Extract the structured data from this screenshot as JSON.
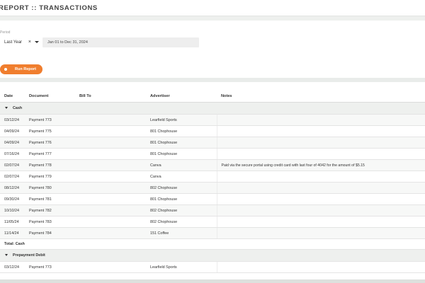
{
  "header": {
    "title": "REPORT :: TRANSACTIONS"
  },
  "filters": {
    "period_label": "Period",
    "period_value": "Last Year",
    "clear_icon": "×",
    "range": "Jan 01 to Dec 31, 2024"
  },
  "actions": {
    "run_label": "Run Report"
  },
  "table": {
    "columns": {
      "date": "Date",
      "document": "Document",
      "bill_to": "Bill To",
      "advertiser": "Advertiser",
      "notes": "Notes"
    },
    "groups": [
      {
        "name": "Cash",
        "rows": [
          {
            "date": "03/12/24",
            "document": "Payment 773",
            "bill_to": "",
            "advertiser": "Learfield Sports",
            "notes": ""
          },
          {
            "date": "04/09/24",
            "document": "Payment 775",
            "bill_to": "",
            "advertiser": "801 Chophouse",
            "notes": ""
          },
          {
            "date": "04/09/24",
            "document": "Payment 776",
            "bill_to": "",
            "advertiser": "801 Chophouse",
            "notes": ""
          },
          {
            "date": "07/16/24",
            "document": "Payment 777",
            "bill_to": "",
            "advertiser": "801 Chophouse",
            "notes": ""
          },
          {
            "date": "02/07/24",
            "document": "Payment 778",
            "bill_to": "",
            "advertiser": "Canva",
            "notes": "Paid via the secure portal using credit card with last four of 4042 for the amount of $5.15"
          },
          {
            "date": "02/07/24",
            "document": "Payment 779",
            "bill_to": "",
            "advertiser": "Canva",
            "notes": ""
          },
          {
            "date": "08/12/24",
            "document": "Payment 780",
            "bill_to": "",
            "advertiser": "802 Chophouse",
            "notes": ""
          },
          {
            "date": "09/30/24",
            "document": "Payment 781",
            "bill_to": "",
            "advertiser": "801 Chophouse",
            "notes": ""
          },
          {
            "date": "10/10/24",
            "document": "Payment 782",
            "bill_to": "",
            "advertiser": "802 Chophouse",
            "notes": ""
          },
          {
            "date": "11/05/24",
            "document": "Payment 783",
            "bill_to": "",
            "advertiser": "802 Chophouse",
            "notes": ""
          },
          {
            "date": "11/14/24",
            "document": "Payment 784",
            "bill_to": "",
            "advertiser": "151 Coffee",
            "notes": ""
          }
        ],
        "total_label": "Total: Cash"
      },
      {
        "name": "Prepayment Debit",
        "rows": [
          {
            "date": "03/12/24",
            "document": "Payment 773",
            "bill_to": "",
            "advertiser": "Learfield Sports",
            "notes": ""
          }
        ]
      }
    ]
  }
}
